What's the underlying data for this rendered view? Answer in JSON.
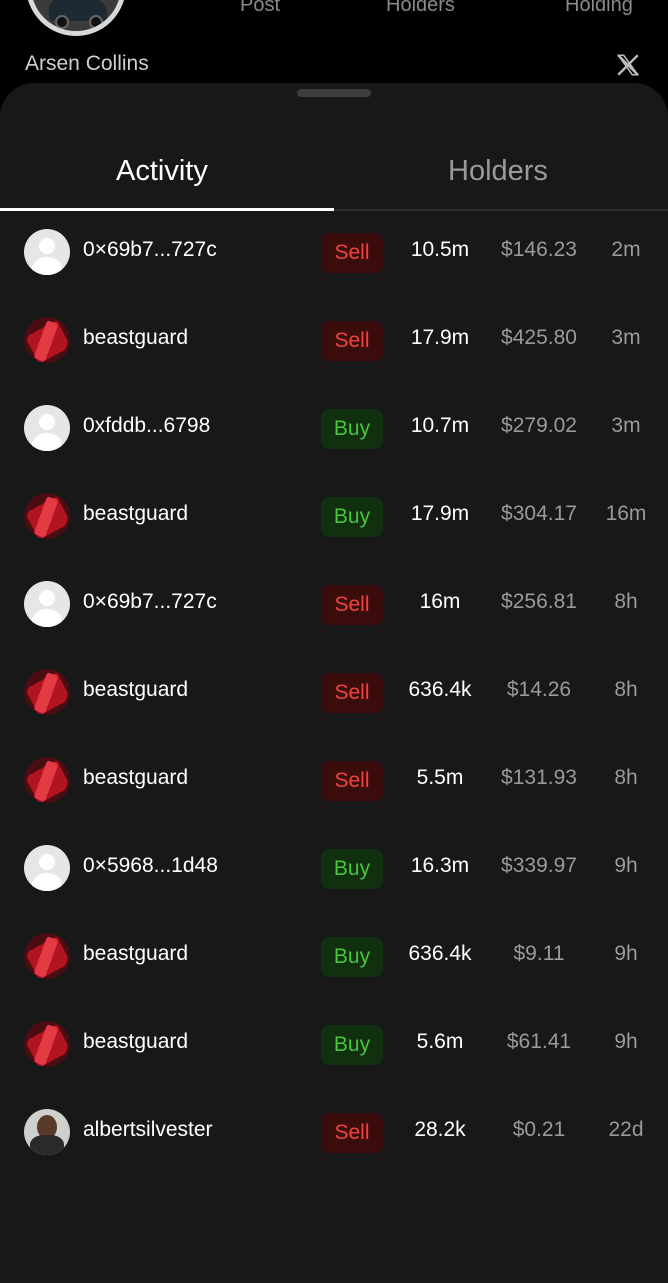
{
  "profile": {
    "name": "Arsen Collins",
    "stats": {
      "post_label": "Post",
      "holders_label": "Holders",
      "holding_label": "Holding"
    },
    "social_icon": "x-logo-icon"
  },
  "tabs": [
    {
      "label": "Activity",
      "active": true
    },
    {
      "label": "Holders",
      "active": false
    }
  ],
  "colors": {
    "sell": "#f2463c",
    "sell_bg": "#3a0c0c",
    "buy": "#48c63b",
    "buy_bg": "#11300f",
    "sheet_bg": "#181818"
  },
  "activity": [
    {
      "avatar": "default",
      "name": "0×69b7...727c",
      "side": "Sell",
      "amount": "10.5m",
      "usd": "$146.23",
      "time": "2m"
    },
    {
      "avatar": "red",
      "name": "beastguard",
      "side": "Sell",
      "amount": "17.9m",
      "usd": "$425.80",
      "time": "3m"
    },
    {
      "avatar": "default",
      "name": "0xfddb...6798",
      "side": "Buy",
      "amount": "10.7m",
      "usd": "$279.02",
      "time": "3m"
    },
    {
      "avatar": "red",
      "name": "beastguard",
      "side": "Buy",
      "amount": "17.9m",
      "usd": "$304.17",
      "time": "16m"
    },
    {
      "avatar": "default",
      "name": "0×69b7...727c",
      "side": "Sell",
      "amount": "16m",
      "usd": "$256.81",
      "time": "8h"
    },
    {
      "avatar": "red",
      "name": "beastguard",
      "side": "Sell",
      "amount": "636.4k",
      "usd": "$14.26",
      "time": "8h"
    },
    {
      "avatar": "red",
      "name": "beastguard",
      "side": "Sell",
      "amount": "5.5m",
      "usd": "$131.93",
      "time": "8h"
    },
    {
      "avatar": "default",
      "name": "0×5968...1d48",
      "side": "Buy",
      "amount": "16.3m",
      "usd": "$339.97",
      "time": "9h"
    },
    {
      "avatar": "red",
      "name": "beastguard",
      "side": "Buy",
      "amount": "636.4k",
      "usd": "$9.11",
      "time": "9h"
    },
    {
      "avatar": "red",
      "name": "beastguard",
      "side": "Buy",
      "amount": "5.6m",
      "usd": "$61.41",
      "time": "9h"
    },
    {
      "avatar": "photo",
      "name": "albertsilvester",
      "side": "Sell",
      "amount": "28.2k",
      "usd": "$0.21",
      "time": "22d"
    }
  ]
}
